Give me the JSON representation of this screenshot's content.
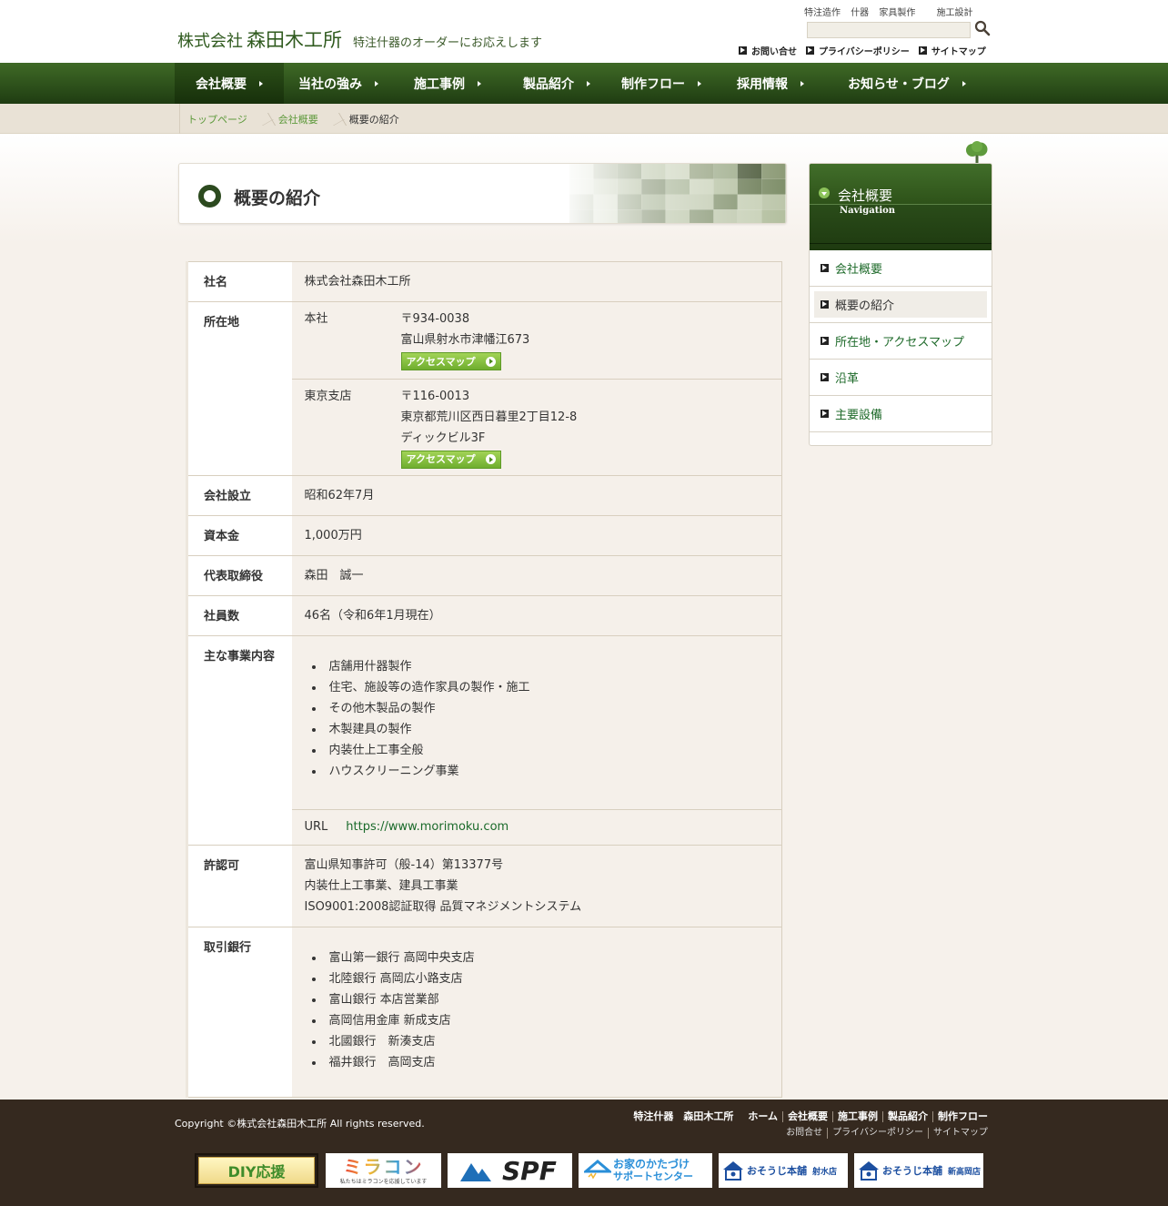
{
  "header": {
    "logo_company_prefix": "株式会社",
    "logo_company_name": "森田木工所",
    "logo_tagline": "特注什器のオーダーにお応えします",
    "keywords": [
      "特注造作",
      "什器",
      "家具製作",
      "施工設計"
    ],
    "search_placeholder": "",
    "utility_links": [
      "お問い合せ",
      "プライバシーポリシー",
      "サイトマップ"
    ]
  },
  "gnav": [
    {
      "label": "会社概要",
      "active": true
    },
    {
      "label": "当社の強み",
      "active": false
    },
    {
      "label": "施工事例",
      "active": false
    },
    {
      "label": "製品紹介",
      "active": false
    },
    {
      "label": "制作フロー",
      "active": false
    },
    {
      "label": "採用情報",
      "active": false
    },
    {
      "label": "お知らせ・ブログ",
      "active": false
    }
  ],
  "breadcrumb": [
    "トップページ",
    "会社概要",
    "概要の紹介"
  ],
  "page_title": "概要の紹介",
  "table": {
    "name_label": "社名",
    "name_value": "株式会社森田木工所",
    "location_label": "所在地",
    "hq_label": "本社",
    "hq_postal": "〒934-0038",
    "hq_address": "富山県射水市津幡江673",
    "tokyo_label": "東京支店",
    "tokyo_postal": "〒116-0013",
    "tokyo_address1": "東京都荒川区西日暮里2丁目12-8",
    "tokyo_address2": "ディックビル3F",
    "map_button": "アクセスマップ",
    "founded_label": "会社設立",
    "founded_value": "昭和62年7月",
    "capital_label": "資本金",
    "capital_value": "1,000万円",
    "ceo_label": "代表取締役",
    "ceo_value": "森田　誠一",
    "employees_label": "社員数",
    "employees_value": "46名（令和6年1月現在）",
    "business_label": "主な事業内容",
    "business_items": [
      "店舗用什器製作",
      "住宅、施設等の造作家具の製作・施工",
      "その他木製品の製作",
      "木製建具の製作",
      "内装仕上工事全般",
      "ハウスクリーニング事業"
    ],
    "url_label": "URL",
    "url_value": "https://www.morimoku.com",
    "license_label": "許認可",
    "license_lines": [
      "富山県知事許可（般-14）第13377号",
      "内装仕上工事業、建具工事業",
      "ISO9001:2008認証取得 品質マネジメントシステム"
    ],
    "bank_label": "取引銀行",
    "bank_items": [
      "富山第一銀行 高岡中央支店",
      "北陸銀行 高岡広小路支店",
      "富山銀行 本店営業部",
      "高岡信用金庫 新成支店",
      "北國銀行　新湊支店",
      "福井銀行　高岡支店"
    ]
  },
  "sidebar": {
    "title": "会社概要",
    "subtitle": "Navigation",
    "items": [
      {
        "label": "会社概要",
        "active": false
      },
      {
        "label": "概要の紹介",
        "active": true
      },
      {
        "label": "所在地・アクセスマップ",
        "active": false
      },
      {
        "label": "沿革",
        "active": false
      },
      {
        "label": "主要設備",
        "active": false
      }
    ]
  },
  "footer": {
    "copyright": "Copyright ©株式会社森田木工所 All rights reserved.",
    "nav_main": [
      "特注什器　森田木工所",
      "ホーム",
      "会社概要",
      "施工事例",
      "製品紹介",
      "制作フロー"
    ],
    "nav_sub": [
      "お問合せ",
      "プライバシーポリシー",
      "サイトマップ"
    ],
    "banners": [
      "DIY応援",
      "ミラコン",
      "SPF",
      "お家のかたづけサポートセンター",
      "おそうじ本舗 射水店",
      "おそうじ本舗 新高岡店"
    ],
    "banner_subtexts": {
      "miracon": "私たちはミラコンを応援しています",
      "katazuke_top": "お家のかたづけ",
      "katazuke_bottom": "サポートセンター",
      "osouji_brand": "おそうじ本舗",
      "osouji_imizu": "射水店",
      "osouji_shintakaoka": "新高岡店"
    }
  },
  "colors": {
    "nav_green": "#2f5519",
    "link_green": "#1e6a2a",
    "accent_lime": "#8cc25a",
    "footer_brown": "#35291f",
    "table_bg": "#f5f0ea"
  }
}
